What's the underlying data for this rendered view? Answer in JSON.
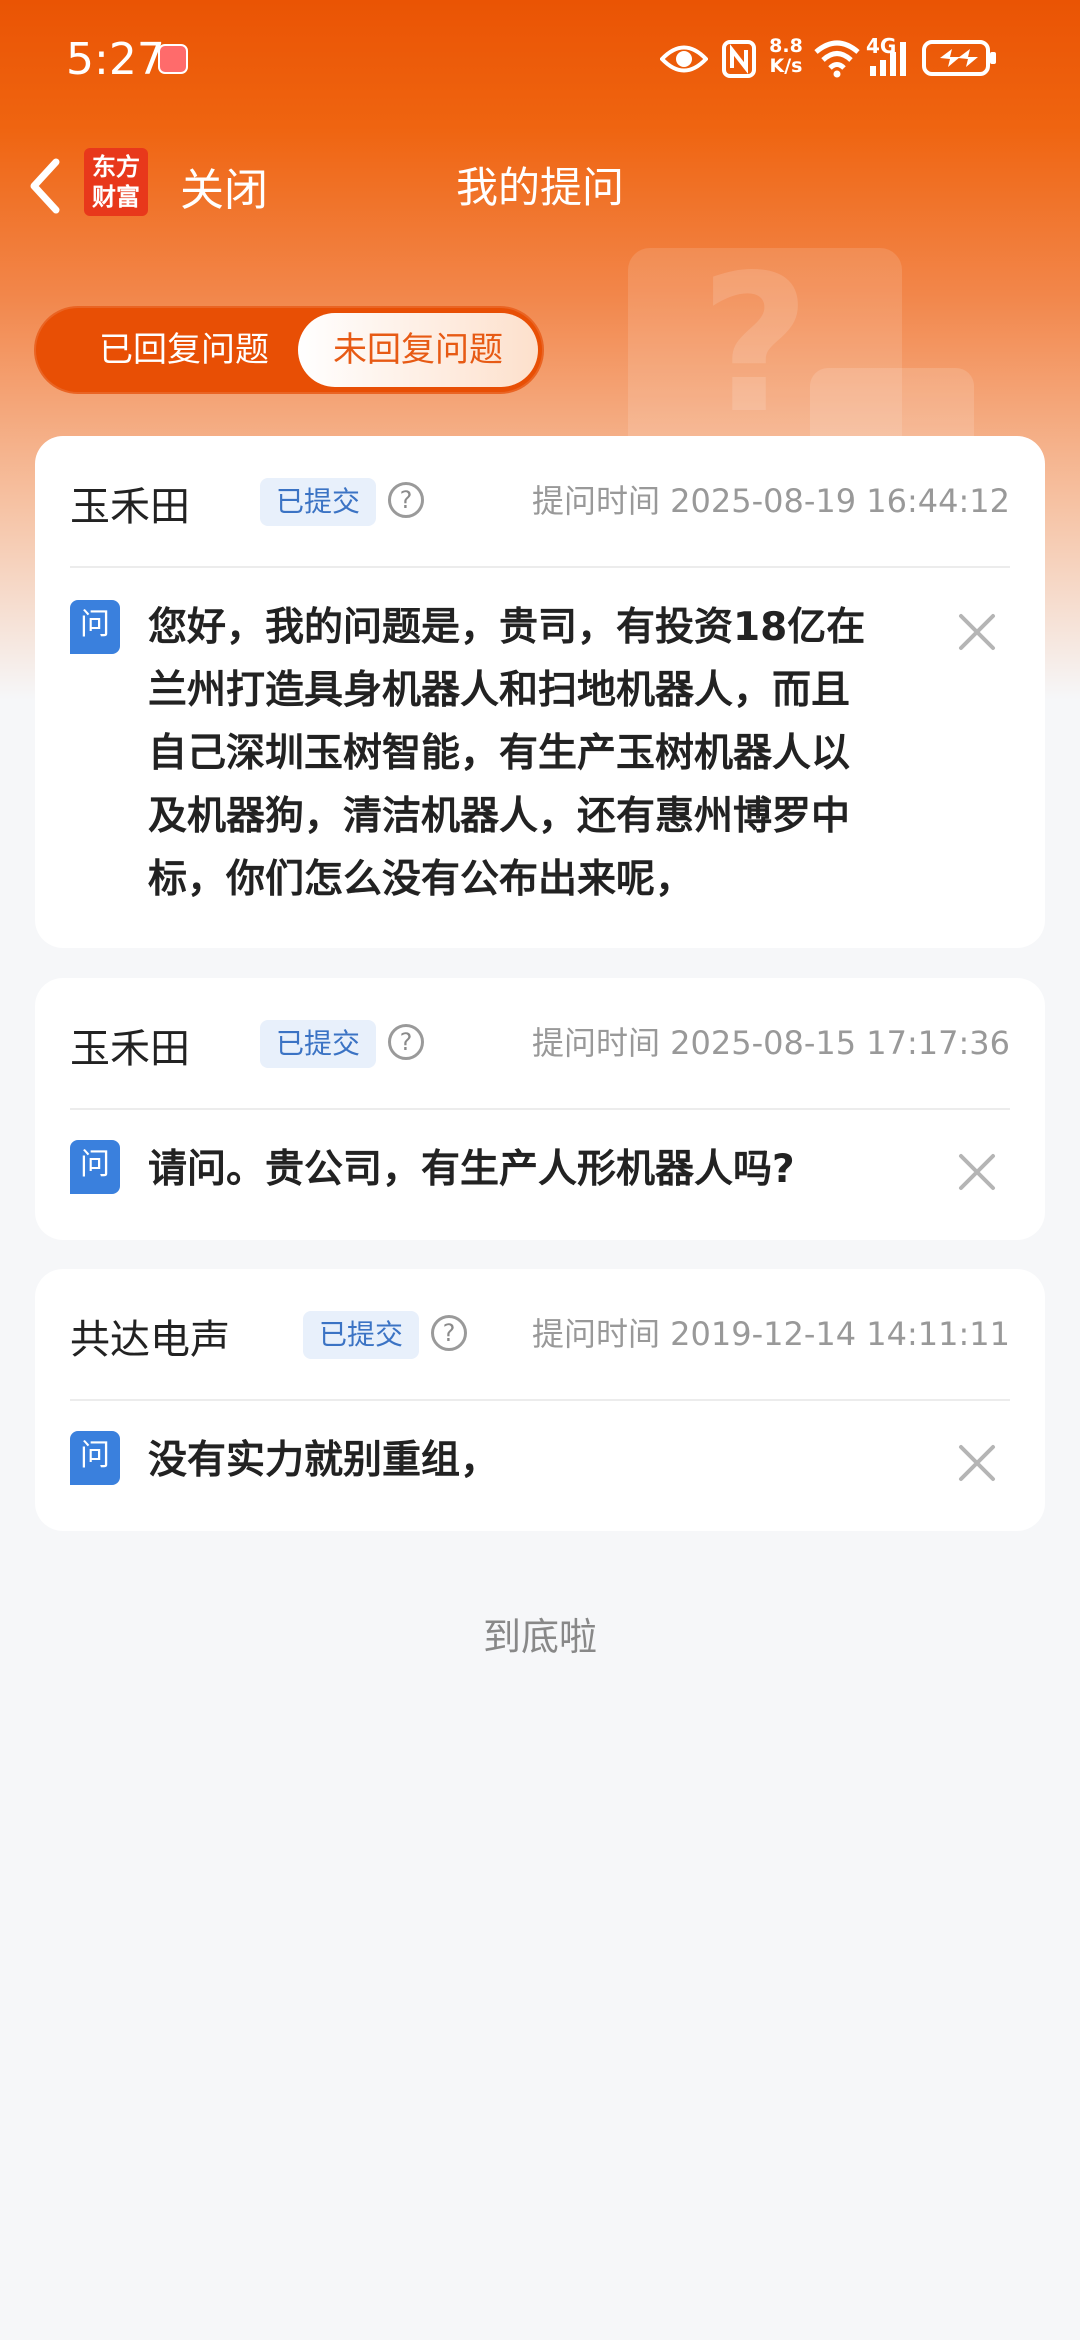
{
  "status_bar": {
    "time": "5:27",
    "net_speed_top": "8.8",
    "net_speed_bottom": "K/s",
    "network": "4G"
  },
  "nav": {
    "logo_line1": "东方",
    "logo_line2": "财富",
    "close_label": "关闭",
    "title": "我的提问"
  },
  "tabs": {
    "replied": "已回复问题",
    "unreplied": "未回复问题",
    "active": "unreplied"
  },
  "questions": [
    {
      "user": "玉禾田",
      "status": "已提交",
      "time_label": "提问时间 2025-08-19 16:44:12",
      "q_icon_text": "问",
      "lines": [
        "您好，我的问题是，贵司，有投资18亿在",
        "兰州打造具身机器人和扫地机器人，而且",
        "自己深圳玉树智能，有生产玉树机器人以",
        "及机器狗，清洁机器人，还有惠州博罗中",
        "标，你们怎么没有公布出来呢，"
      ]
    },
    {
      "user": "玉禾田",
      "status": "已提交",
      "time_label": "提问时间 2025-08-15 17:17:36",
      "q_icon_text": "问",
      "lines": [
        "请问。贵公司，有生产人形机器人吗?"
      ]
    },
    {
      "user": "共达电声",
      "status": "已提交",
      "time_label": "提问时间 2019-12-14 14:11:11",
      "q_icon_text": "问",
      "lines": [
        "没有实力就别重组，"
      ]
    }
  ],
  "help_glyph": "?",
  "footer": {
    "end_text": "到底啦"
  },
  "colors": {
    "brand": "#ea5404",
    "badge": "#3b73c4",
    "q_icon": "#3a80dd"
  }
}
